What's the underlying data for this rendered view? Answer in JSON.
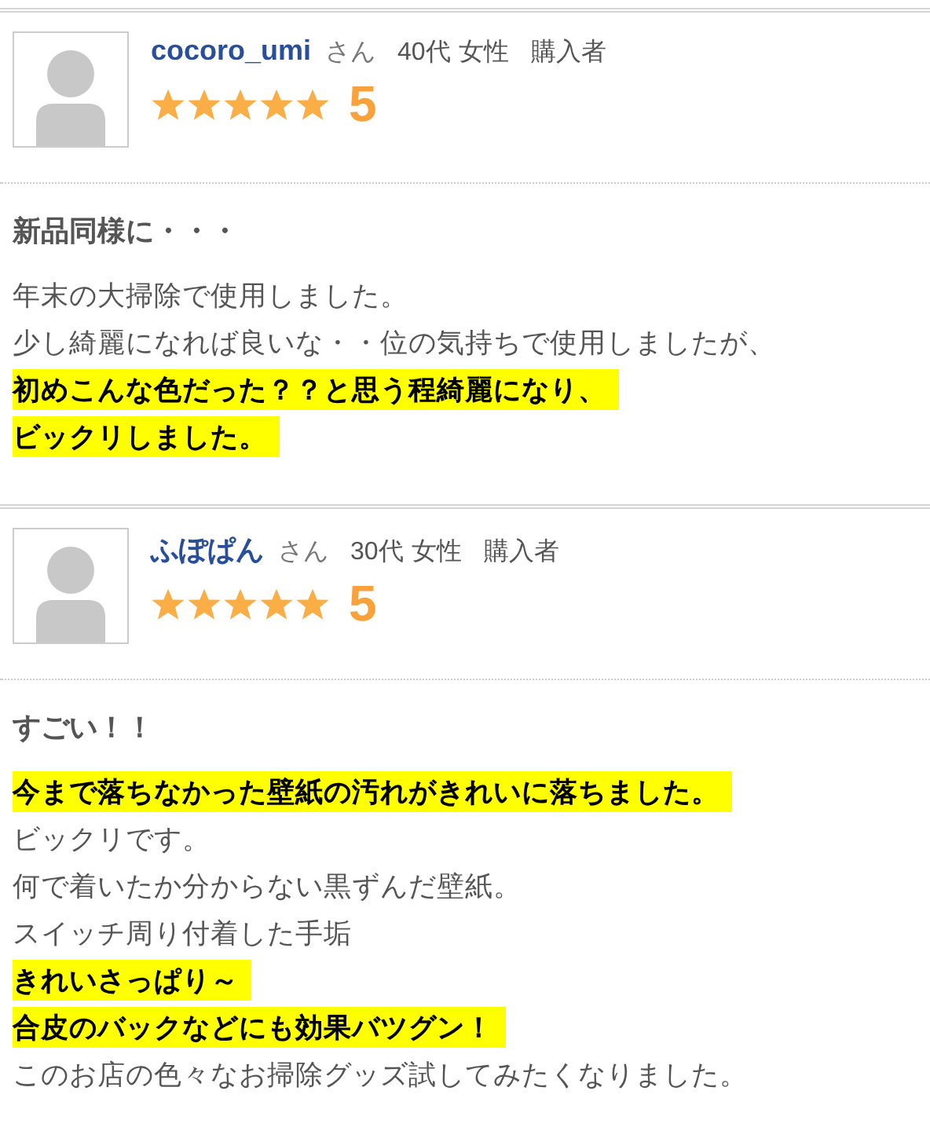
{
  "reviews": [
    {
      "user": {
        "name": "cocoro_umi",
        "honorific": "さん",
        "age": "40代",
        "gender": "女性",
        "status": "購入者"
      },
      "stars": 5,
      "score": "5",
      "title": "新品同様に・・・",
      "lines": [
        {
          "text": "年末の大掃除で使用しました。",
          "highlighted": false
        },
        {
          "text": "少し綺麗になれば良いな・・位の気持ちで使用しましたが、",
          "highlighted": false
        },
        {
          "text": "初めこんな色だった？？と思う程綺麗になり、",
          "highlighted": true
        },
        {
          "text": "ビックリしました。",
          "highlighted": true
        }
      ]
    },
    {
      "user": {
        "name": "ふぽぱん",
        "honorific": "さん",
        "age": "30代",
        "gender": "女性",
        "status": "購入者"
      },
      "stars": 5,
      "score": "5",
      "title": "すごい！！",
      "lines": [
        {
          "text": "今まで落ちなかった壁紙の汚れがきれいに落ちました。",
          "highlighted": true
        },
        {
          "text": "ビックリです。",
          "highlighted": false
        },
        {
          "text": "何で着いたか分からない黒ずんだ壁紙。",
          "highlighted": false
        },
        {
          "text": "スイッチ周り付着した手垢",
          "highlighted": false
        },
        {
          "text": "きれいさっぱり～",
          "highlighted": true
        },
        {
          "text": "合皮のバックなどにも効果バツグン！",
          "highlighted": true
        },
        {
          "text": "このお店の色々なお掃除グッズ試してみたくなりました。",
          "highlighted": false
        }
      ]
    }
  ]
}
